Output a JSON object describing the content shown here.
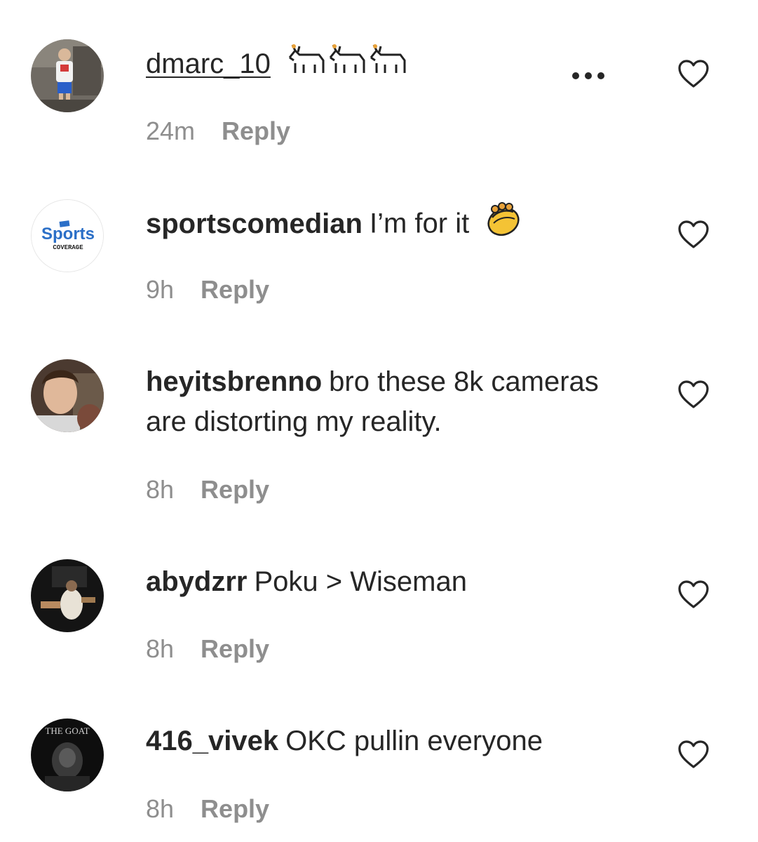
{
  "comments": [
    {
      "username": "dmarc_10",
      "text": "",
      "emoji": "🐐🐐🐐",
      "time": "24m",
      "reply": "Reply",
      "avatar_icon": "person-photo-avatar"
    },
    {
      "username": "sportscomedian",
      "text": "I’m for it",
      "emoji": "👏",
      "time": "9h",
      "reply": "Reply",
      "avatar_icon": "sports-coverage-logo",
      "avatar_logo_text": "Sports",
      "avatar_logo_subtext": "COVERAGE"
    },
    {
      "username": "heyitsbrenno",
      "text": "bro these 8k cameras are distorting my reality.",
      "time": "8h",
      "reply": "Reply",
      "avatar_icon": "face-photo-avatar"
    },
    {
      "username": "abydzrr",
      "text": "Poku > Wiseman",
      "time": "8h",
      "reply": "Reply",
      "avatar_icon": "dark-photo-avatar"
    },
    {
      "username": "416_vivek",
      "text": "OKC pullin everyone",
      "time": "8h",
      "reply": "Reply",
      "avatar_icon": "goat-poster-avatar",
      "avatar_logo_text": "THE GOAT"
    }
  ],
  "colors": {
    "text": "#262626",
    "muted": "#8e8e8e",
    "logo_blue": "#2b6fc7",
    "clap": "#f4c335"
  }
}
